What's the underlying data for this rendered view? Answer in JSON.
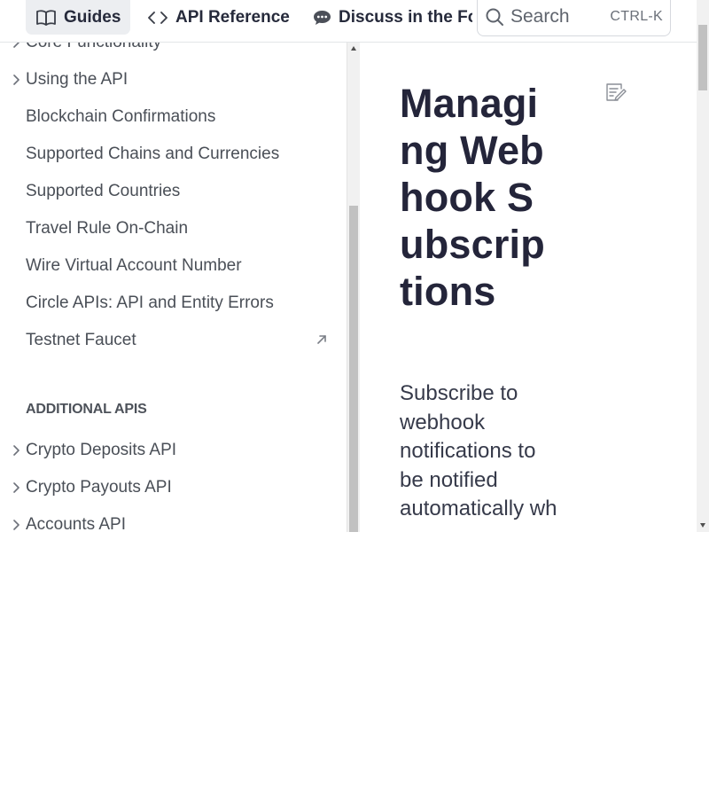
{
  "nav": {
    "tabs": [
      {
        "label": "Guides",
        "icon": "book-open-icon"
      },
      {
        "label": "API Reference",
        "icon": "code-brackets-icon"
      },
      {
        "label": "Discuss in the Forum",
        "icon": "chat-bubble-icon"
      }
    ],
    "search": {
      "label": "Search",
      "shortcut": "CTRL-K"
    }
  },
  "sidebar": {
    "items": [
      {
        "label": "Core Functionality",
        "expandable": true
      },
      {
        "label": "Using the API",
        "expandable": true
      },
      {
        "label": "Blockchain Confirmations",
        "expandable": false
      },
      {
        "label": "Supported Chains and Currencies",
        "expandable": false
      },
      {
        "label": "Supported Countries",
        "expandable": false
      },
      {
        "label": "Travel Rule On-Chain",
        "expandable": false
      },
      {
        "label": "Wire Virtual Account Number",
        "expandable": false
      },
      {
        "label": "Circle APIs: API and Entity Errors",
        "expandable": false
      },
      {
        "label": "Testnet Faucet",
        "expandable": false,
        "external": true
      }
    ],
    "section_heading": "ADDITIONAL APIS",
    "section_items": [
      {
        "label": "Crypto Deposits API",
        "expandable": true
      },
      {
        "label": "Crypto Payouts API",
        "expandable": true
      },
      {
        "label": "Accounts API",
        "expandable": true
      }
    ]
  },
  "main": {
    "title": "Managing Webhook Subscriptions",
    "description": "Subscribe to webhook notifications to be notified automatically wh"
  },
  "colors": {
    "title": "#24253a",
    "text": "#4a4f57",
    "active_tab_bg": "#eceef1",
    "border": "#e3e5e8"
  }
}
